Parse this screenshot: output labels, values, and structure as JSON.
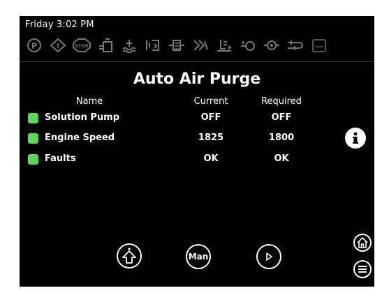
{
  "header": {
    "clock": "Friday 3:02 PM"
  },
  "status_icons": [
    {
      "name": "parking-brake-icon",
      "label": "P"
    },
    {
      "name": "warning-icon",
      "label": "!"
    },
    {
      "name": "stop-icon",
      "label": "STOP"
    },
    {
      "name": "tank-level-icon",
      "label": ""
    },
    {
      "name": "coolant-icon",
      "label": ""
    },
    {
      "name": "pressure-icon",
      "label": ""
    },
    {
      "name": "filter-icon",
      "label": ""
    },
    {
      "name": "fan-icon",
      "label": ""
    },
    {
      "name": "oil-level-icon",
      "label": ""
    },
    {
      "name": "engine-icon",
      "label": ""
    },
    {
      "name": "oil-pressure-icon",
      "label": ""
    },
    {
      "name": "hose-icon",
      "label": ""
    },
    {
      "name": "reservoir-icon",
      "label": ""
    }
  ],
  "page": {
    "title": "Auto Air Purge"
  },
  "table": {
    "headers": {
      "name": "Name",
      "current": "Current",
      "required": "Required"
    },
    "rows": [
      {
        "name": "Solution Pump",
        "current": "OFF",
        "required": "OFF"
      },
      {
        "name": "Engine Speed",
        "current": "1825",
        "required": "1800"
      },
      {
        "name": "Faults",
        "current": "OK",
        "required": "OK"
      }
    ]
  },
  "buttons": {
    "manual_label": "Man"
  },
  "colors": {
    "led_ok": "#5fd35a",
    "background": "#000000",
    "foreground": "#ffffff",
    "inactive_icon": "#6a6a6a"
  }
}
